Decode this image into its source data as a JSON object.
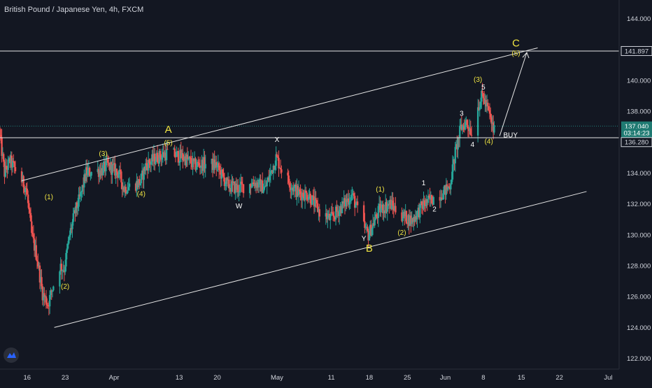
{
  "title": "British Pound / Japanese Yen, 4h, FXCM",
  "colors": {
    "background": "#131722",
    "up": "#26a69a",
    "down": "#ef5350",
    "line": "#e6e6e6",
    "wave_label": "#f0e442",
    "axis_text": "#d1d4dc",
    "tv_logo": "#2962ff"
  },
  "icons": {
    "logo": "tradingview-logo-icon"
  },
  "chart_data": {
    "type": "candlestick",
    "title": "British Pound / Japanese Yen, 4h, FXCM",
    "ylim": [
      121.3,
      145.2
    ],
    "xlim": [
      "2020-03-11",
      "2020-07-03"
    ],
    "y_ticks": [
      122.0,
      124.0,
      126.0,
      128.0,
      130.0,
      132.0,
      134.0,
      138.0,
      140.0,
      144.0
    ],
    "x_ticks": [
      {
        "date": "2020-03-16",
        "label": "16"
      },
      {
        "date": "2020-03-23",
        "label": "23"
      },
      {
        "date": "2020-04-01",
        "label": "Apr"
      },
      {
        "date": "2020-04-13",
        "label": "13"
      },
      {
        "date": "2020-04-20",
        "label": "20"
      },
      {
        "date": "2020-05-01",
        "label": "May"
      },
      {
        "date": "2020-05-11",
        "label": "11"
      },
      {
        "date": "2020-05-18",
        "label": "18"
      },
      {
        "date": "2020-05-25",
        "label": "25"
      },
      {
        "date": "2020-06-01",
        "label": "Jun"
      },
      {
        "date": "2020-06-08",
        "label": "8"
      },
      {
        "date": "2020-06-15",
        "label": "15"
      },
      {
        "date": "2020-06-22",
        "label": "22"
      },
      {
        "date": "2020-07-01",
        "label": "Jul"
      }
    ],
    "price_path": [
      [
        "2020-03-11",
        136.8
      ],
      [
        "2020-03-12",
        134.0
      ],
      [
        "2020-03-13",
        134.8
      ],
      [
        "2020-03-16",
        133.0
      ],
      [
        "2020-03-17",
        130.0
      ],
      [
        "2020-03-18",
        128.5
      ],
      [
        "2020-03-19",
        126.2
      ],
      [
        "2020-03-20",
        125.5
      ],
      [
        "2020-03-22",
        128.0
      ],
      [
        "2020-03-23",
        127.8
      ],
      [
        "2020-03-24",
        130.0
      ],
      [
        "2020-03-25",
        131.5
      ],
      [
        "2020-03-26",
        132.5
      ],
      [
        "2020-03-27",
        134.0
      ],
      [
        "2020-03-30",
        134.2
      ],
      [
        "2020-03-31",
        134.5
      ],
      [
        "2020-04-02",
        134.0
      ],
      [
        "2020-04-03",
        133.0
      ],
      [
        "2020-04-06",
        133.4
      ],
      [
        "2020-04-07",
        134.5
      ],
      [
        "2020-04-09",
        135.0
      ],
      [
        "2020-04-11",
        135.3
      ],
      [
        "2020-04-14",
        135.0
      ],
      [
        "2020-04-16",
        134.5
      ],
      [
        "2020-04-18",
        134.6
      ],
      [
        "2020-04-20",
        134.5
      ],
      [
        "2020-04-22",
        133.2
      ],
      [
        "2020-04-24",
        133.0
      ],
      [
        "2020-04-27",
        133.4
      ],
      [
        "2020-04-29",
        133.0
      ],
      [
        "2020-05-01",
        135.0
      ],
      [
        "2020-05-03",
        133.6
      ],
      [
        "2020-05-05",
        132.7
      ],
      [
        "2020-05-07",
        132.6
      ],
      [
        "2020-05-09",
        131.5
      ],
      [
        "2020-05-11",
        131.0
      ],
      [
        "2020-05-13",
        131.8
      ],
      [
        "2020-05-15",
        132.6
      ],
      [
        "2020-05-17",
        130.6
      ],
      [
        "2020-05-18",
        130.0
      ],
      [
        "2020-05-20",
        131.6
      ],
      [
        "2020-05-22",
        132.0
      ],
      [
        "2020-05-24",
        131.3
      ],
      [
        "2020-05-26",
        130.9
      ],
      [
        "2020-05-28",
        131.9
      ],
      [
        "2020-05-30",
        132.4
      ],
      [
        "2020-06-01",
        132.8
      ],
      [
        "2020-06-02",
        133.2
      ],
      [
        "2020-06-03",
        135.3
      ],
      [
        "2020-06-04",
        136.9
      ],
      [
        "2020-06-05",
        137.3
      ],
      [
        "2020-06-06",
        136.7
      ],
      [
        "2020-06-07",
        138.2
      ],
      [
        "2020-06-08",
        139.0
      ],
      [
        "2020-06-09",
        138.1
      ],
      [
        "2020-06-10",
        136.8
      ]
    ],
    "horizontal_lines": [
      {
        "name": "resistance",
        "y": 141.897
      },
      {
        "name": "support",
        "y": 136.28
      }
    ],
    "trendlines": [
      {
        "name": "upper-channel",
        "from": {
          "date": "2020-03-15",
          "y": 133.5
        },
        "to": {
          "date": "2020-06-18",
          "y": 142.1
        }
      },
      {
        "name": "lower-channel",
        "from": {
          "date": "2020-03-21",
          "y": 124.0
        },
        "to": {
          "date": "2020-06-27",
          "y": 132.8
        }
      },
      {
        "name": "projection",
        "from": {
          "date": "2020-06-11",
          "y": 136.4
        },
        "to": {
          "date": "2020-06-16",
          "y": 141.8
        }
      }
    ],
    "price_labels": [
      {
        "text": "141.897",
        "y": 141.897,
        "style": "outline"
      },
      {
        "text": "137.040",
        "y": 137.04,
        "style": "teal"
      },
      {
        "text": "03:14:23",
        "y": 136.6,
        "style": "teal"
      },
      {
        "text": "136.280",
        "y": 136.0,
        "style": "outline"
      }
    ],
    "annotations": [
      {
        "text": "(1)",
        "date": "2020-03-20",
        "y": 132.3,
        "color": "yellow"
      },
      {
        "text": "(2)",
        "date": "2020-03-23",
        "y": 126.5,
        "color": "yellow"
      },
      {
        "text": "(3)",
        "date": "2020-03-30",
        "y": 135.1,
        "color": "yellow"
      },
      {
        "text": "(4)",
        "date": "2020-04-06",
        "y": 132.5,
        "color": "yellow"
      },
      {
        "text": "(5)",
        "date": "2020-04-11",
        "y": 135.8,
        "color": "yellow"
      },
      {
        "text": "A",
        "date": "2020-04-11",
        "y": 136.6,
        "color": "yellow-big"
      },
      {
        "text": "W",
        "date": "2020-04-24",
        "y": 131.7,
        "color": "white"
      },
      {
        "text": "X",
        "date": "2020-05-01",
        "y": 136.0,
        "color": "white"
      },
      {
        "text": "Y",
        "date": "2020-05-17",
        "y": 129.6,
        "color": "white"
      },
      {
        "text": "B",
        "date": "2020-05-18",
        "y": 128.9,
        "color": "yellow-big"
      },
      {
        "text": "(1)",
        "date": "2020-05-20",
        "y": 132.8,
        "color": "yellow"
      },
      {
        "text": "(2)",
        "date": "2020-05-24",
        "y": 130.0,
        "color": "yellow"
      },
      {
        "text": "1",
        "date": "2020-05-28",
        "y": 133.2,
        "color": "white"
      },
      {
        "text": "2",
        "date": "2020-05-30",
        "y": 131.5,
        "color": "white"
      },
      {
        "text": "3",
        "date": "2020-06-04",
        "y": 137.7,
        "color": "white"
      },
      {
        "text": "4",
        "date": "2020-06-06",
        "y": 135.7,
        "color": "white"
      },
      {
        "text": "(3)",
        "date": "2020-06-07",
        "y": 139.9,
        "color": "yellow"
      },
      {
        "text": "5",
        "date": "2020-06-08",
        "y": 139.4,
        "color": "white"
      },
      {
        "text": "(4)",
        "date": "2020-06-09",
        "y": 135.9,
        "color": "yellow"
      },
      {
        "text": "BUY",
        "date": "2020-06-13",
        "y": 136.3,
        "color": "white"
      },
      {
        "text": "(5)",
        "date": "2020-06-14",
        "y": 141.6,
        "color": "yellow"
      },
      {
        "text": "C",
        "date": "2020-06-14",
        "y": 142.2,
        "color": "yellow-big"
      }
    ]
  }
}
